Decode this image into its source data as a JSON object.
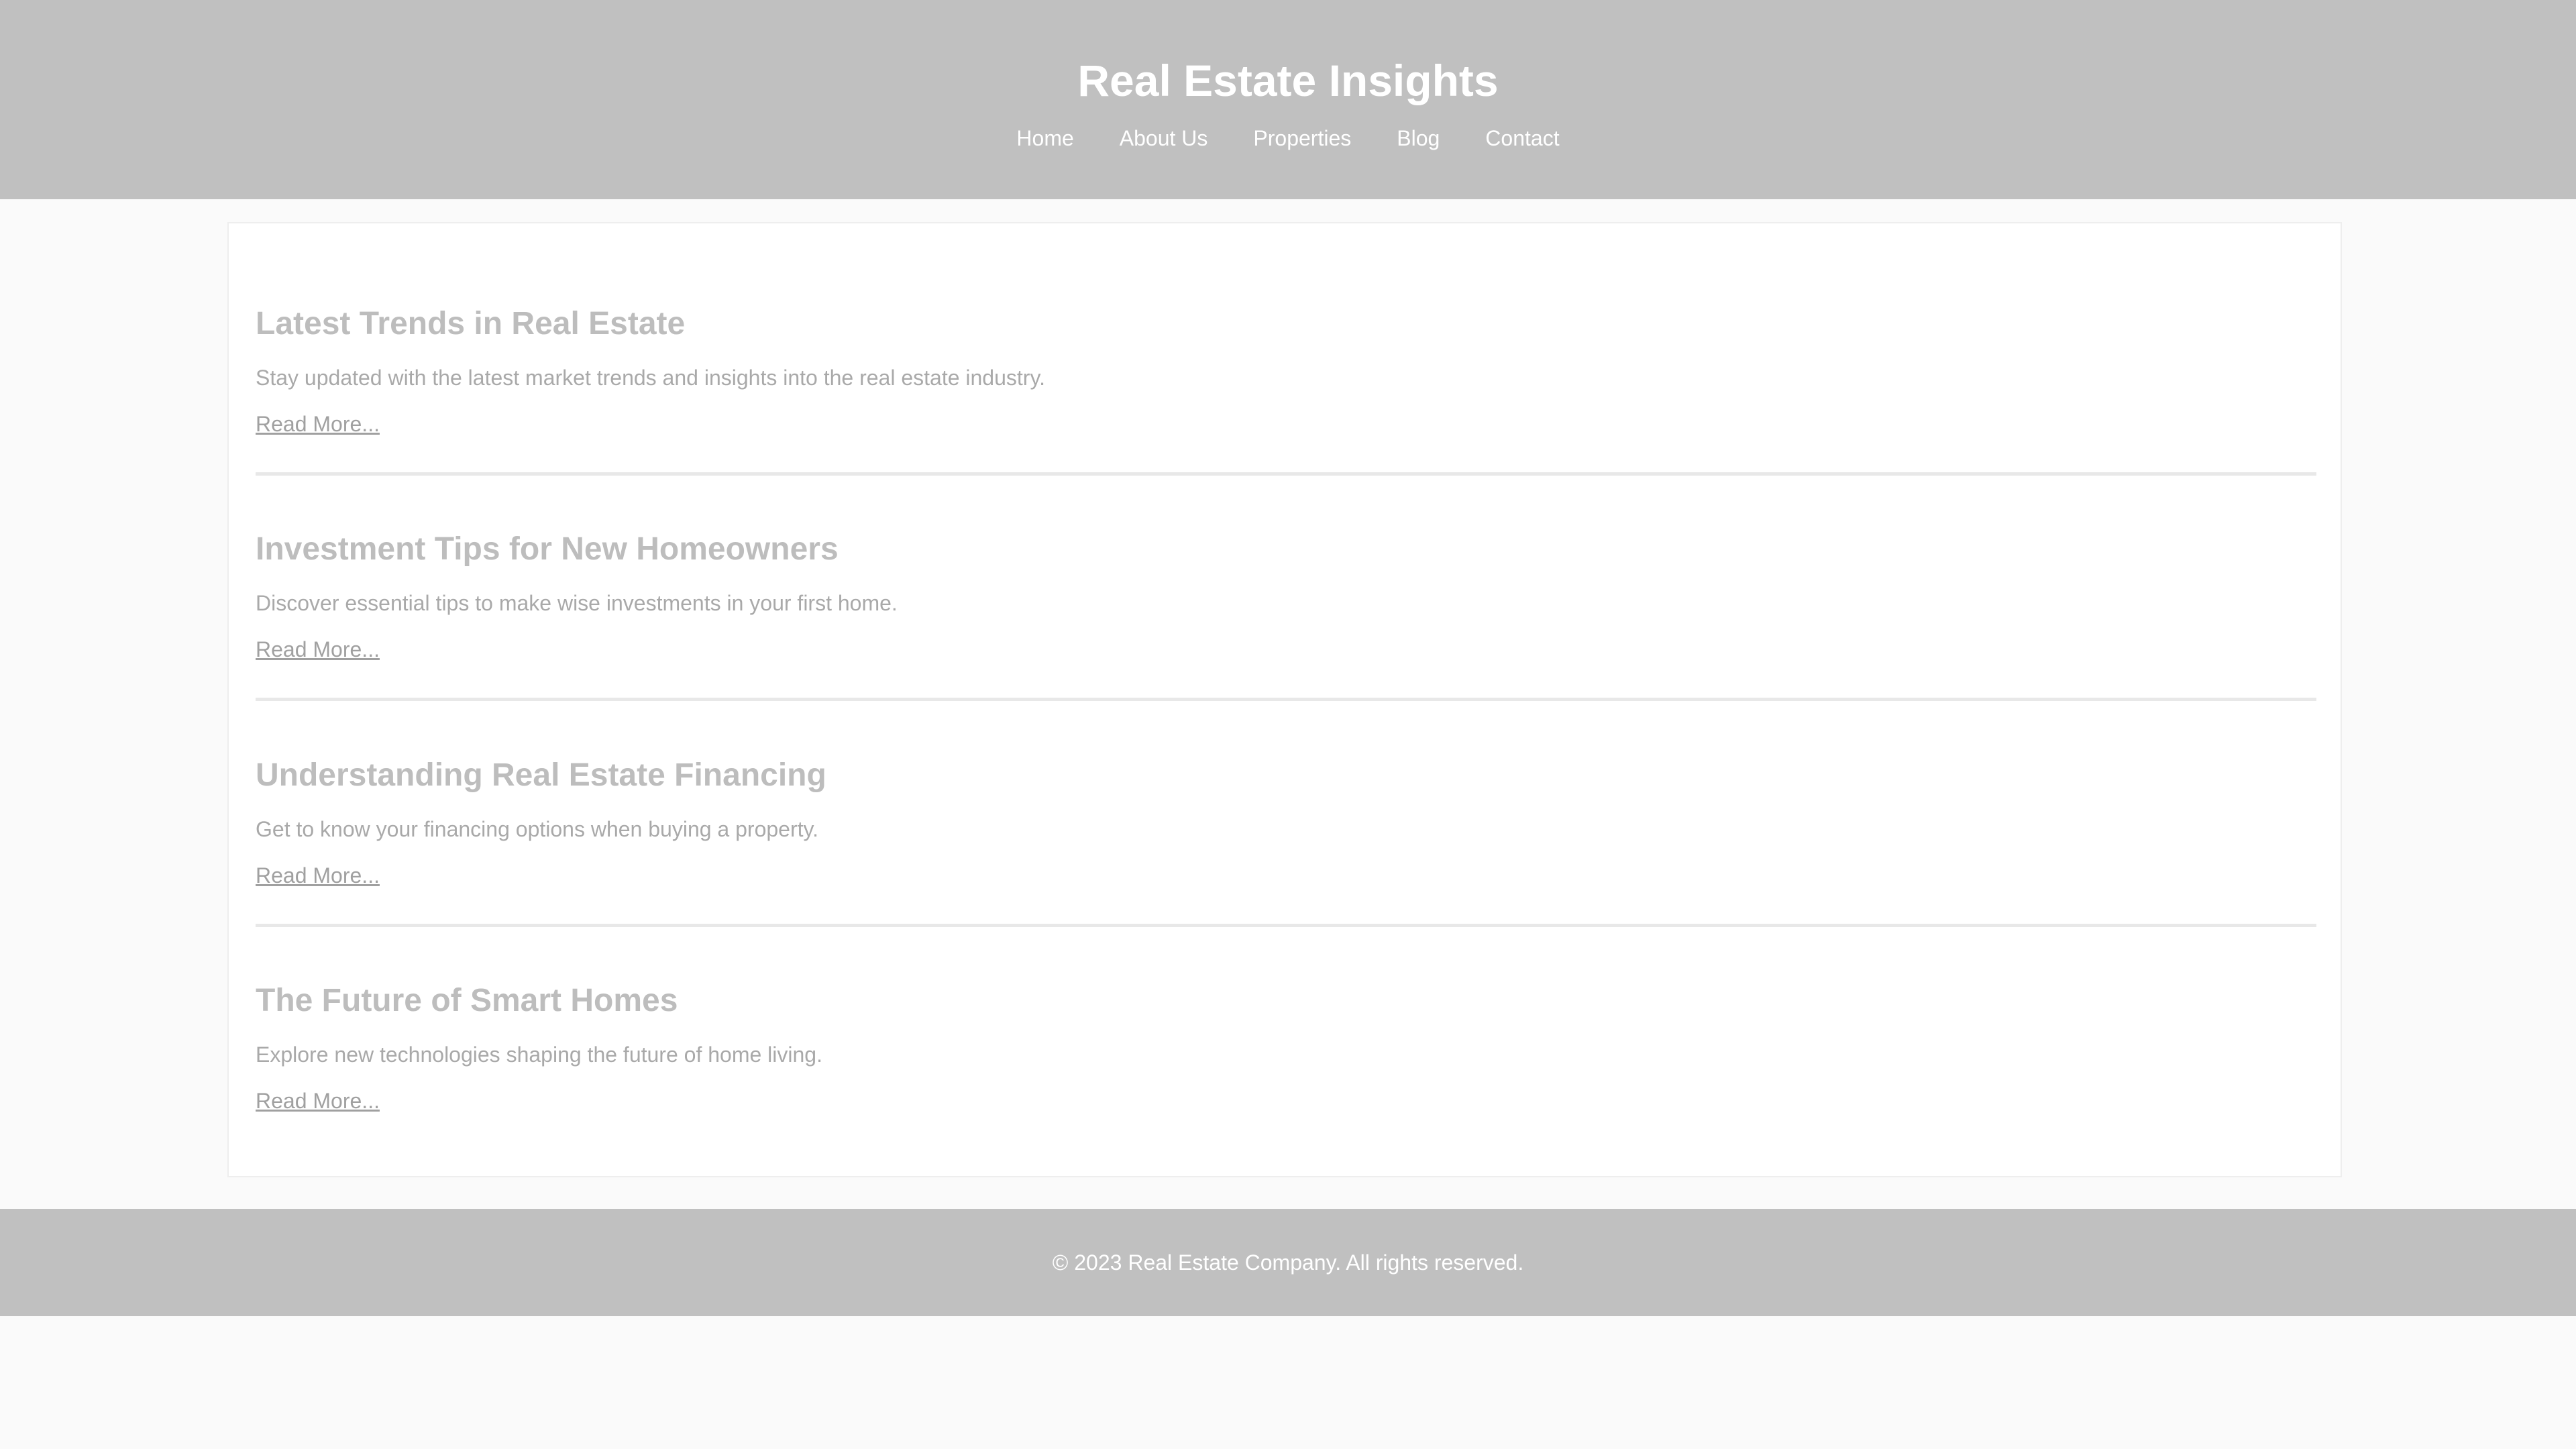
{
  "header": {
    "title": "Real Estate Insights",
    "nav": [
      "Home",
      "About Us",
      "Properties",
      "Blog",
      "Contact"
    ]
  },
  "posts": [
    {
      "title": "Latest Trends in Real Estate",
      "summary": "Stay updated with the latest market trends and insights into the real estate industry.",
      "link": "Read More..."
    },
    {
      "title": "Investment Tips for New Homeowners",
      "summary": "Discover essential tips to make wise investments in your first home.",
      "link": "Read More..."
    },
    {
      "title": "Understanding Real Estate Financing",
      "summary": "Get to know your financing options when buying a property.",
      "link": "Read More..."
    },
    {
      "title": "The Future of Smart Homes",
      "summary": "Explore new technologies shaping the future of home living.",
      "link": "Read More..."
    }
  ],
  "footer": {
    "text": "© 2023 Real Estate Company. All rights reserved."
  },
  "colors": {
    "header_background": "#c0c0c0",
    "page_background": "#fafafa",
    "post_title": "#bdbdbd",
    "post_text": "#a9a9a9"
  }
}
